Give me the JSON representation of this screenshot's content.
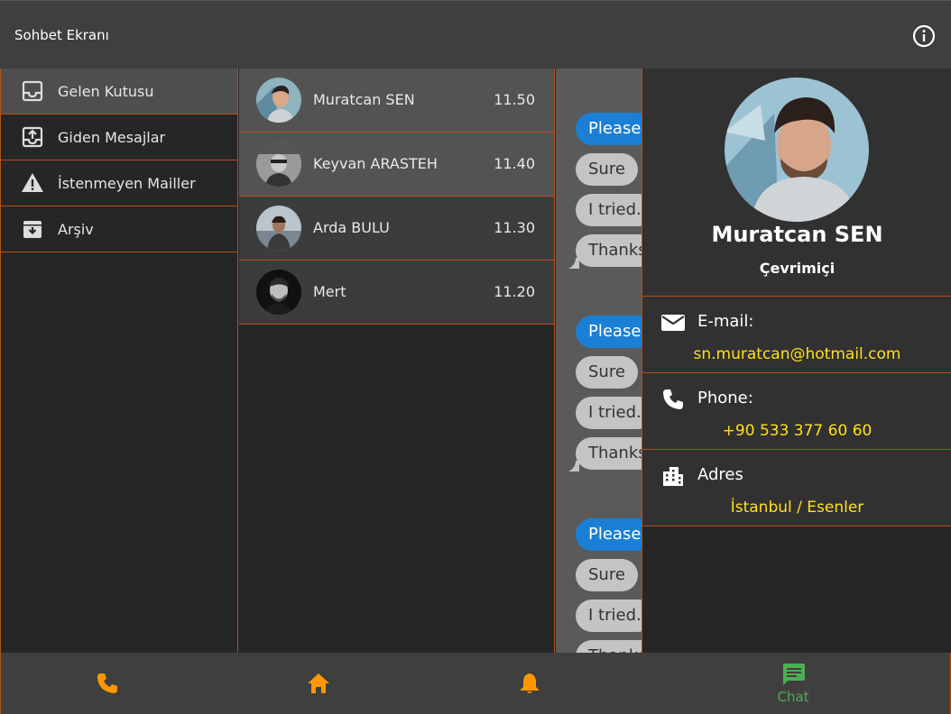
{
  "app": {
    "title": "Sohbet Ekranı"
  },
  "sidebar": {
    "items": [
      {
        "label": "Gelen Kutusu",
        "icon": "inbox-icon",
        "active": true
      },
      {
        "label": "Giden Mesajlar",
        "icon": "outbox-icon",
        "active": false
      },
      {
        "label": "İstenmeyen Mailler",
        "icon": "warning-icon",
        "active": false
      },
      {
        "label": "Arşiv",
        "icon": "archive-icon",
        "active": false
      }
    ]
  },
  "contacts": [
    {
      "name": "Muratcan SEN",
      "time": "11.50"
    },
    {
      "name": "Keyvan ARASTEH",
      "time": "11.40"
    },
    {
      "name": "Arda BULU",
      "time": "11.30"
    },
    {
      "name": "Mert",
      "time": "11.20"
    }
  ],
  "chat": {
    "messages": [
      {
        "text": "Please",
        "kind": "blue"
      },
      {
        "text": "Sure",
        "kind": "gray"
      },
      {
        "text": "I tried.",
        "kind": "gray"
      },
      {
        "text": "Thanks",
        "kind": "gray"
      },
      {
        "text": "Please",
        "kind": "blue"
      },
      {
        "text": "Sure",
        "kind": "gray"
      },
      {
        "text": "I tried.",
        "kind": "gray"
      },
      {
        "text": "Thanks",
        "kind": "gray"
      },
      {
        "text": "Please",
        "kind": "blue"
      },
      {
        "text": "Sure",
        "kind": "gray"
      },
      {
        "text": "I tried.",
        "kind": "gray"
      },
      {
        "text": "Thanks",
        "kind": "gray"
      }
    ]
  },
  "profile": {
    "name": "Muratcan SEN",
    "status": "Çevrimiçi",
    "email_label": "E-mail:",
    "email": "sn.muratcan@hotmail.com",
    "phone_label": "Phone:",
    "phone": "+90 533 377 60 60",
    "address_label": "Adres",
    "address": "İstanbul / Esenler"
  },
  "bottom_nav": {
    "tabs": [
      {
        "icon": "phone-icon",
        "label": ""
      },
      {
        "icon": "home-icon",
        "label": ""
      },
      {
        "icon": "bell-icon",
        "label": ""
      },
      {
        "icon": "chat-icon",
        "label": "Chat"
      }
    ]
  },
  "colors": {
    "accent_orange": "#ff9800",
    "active_green": "#4caf50",
    "divider": "#b4501e",
    "value_yellow": "#ffe01b",
    "message_blue": "#1b7fd6"
  }
}
